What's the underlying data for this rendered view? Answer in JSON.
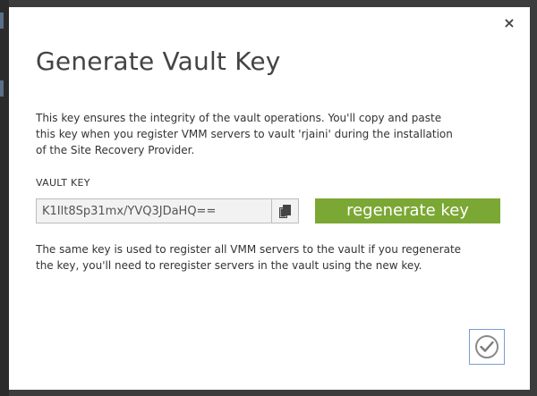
{
  "dialog": {
    "close_glyph": "×",
    "title": "Generate Vault Key",
    "description": "This key ensures the integrity of the vault operations. You'll copy and paste this key when you register VMM servers to vault 'rjaini' during the installation of the Site Recovery Provider.",
    "vault_key_label": "VAULT KEY",
    "vault_key_value": "K1Ilt8Sp31mx/YVQ3JDaHQ==",
    "regenerate_label": "regenerate key",
    "note": "The same key is used to register all VMM servers to the vault if you regenerate the key, you'll need to reregister servers in the vault using the new key.",
    "icons": {
      "close": "close-icon",
      "copy": "copy-icon",
      "confirm": "checkmark-icon"
    },
    "colors": {
      "regenerate_button": "#7ba734",
      "confirm_border": "#7a9bd6",
      "title_text": "#444444"
    }
  }
}
